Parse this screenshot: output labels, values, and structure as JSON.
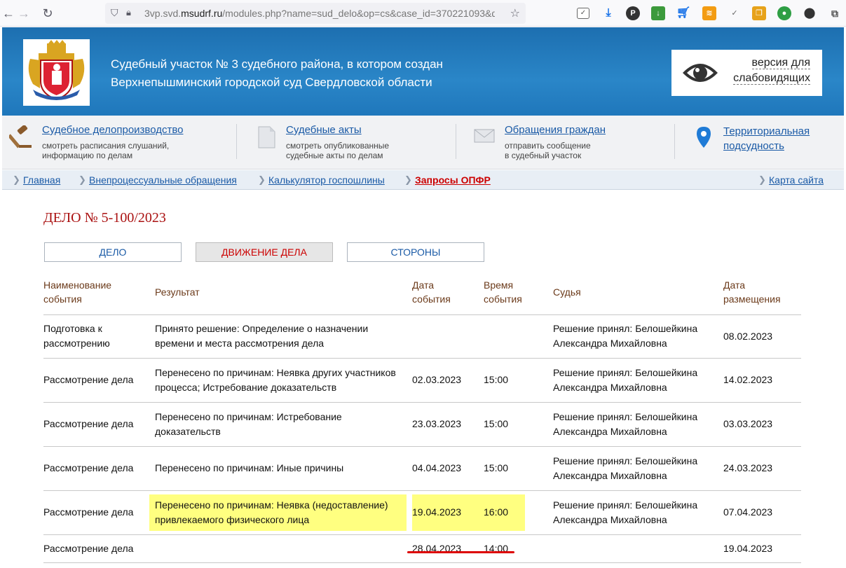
{
  "browser": {
    "url_prefix": "3vp.svd.",
    "url_domain": "msudrf.ru",
    "url_rest": "/modules.php?name=sud_delo&op=cs&case_id=370221093&de"
  },
  "header": {
    "title_line1": "Судебный участок № 3 судебного района, в котором создан",
    "title_line2": "Верхнепышминский городской суд Свердловской области",
    "accessibility_line1": "версия для",
    "accessibility_line2": "слабовидящих"
  },
  "quick_links": [
    {
      "title": "Судебное делопроизводство",
      "desc1": "смотреть расписания слушаний,",
      "desc2": "информацию по делам"
    },
    {
      "title": "Судебные акты",
      "desc1": "смотреть опубликованные",
      "desc2": "судебные акты по делам"
    },
    {
      "title": "Обращения граждан",
      "desc1": "отправить сообщение",
      "desc2": "в судебный участок"
    },
    {
      "title": "Территориальная",
      "title2": "подсудность"
    }
  ],
  "breadcrumbs": {
    "home": "Главная",
    "extra": "Внепроцессуальные обращения",
    "calc": "Калькулятор госпошлины",
    "opfr": "Запросы ОПФР",
    "sitemap": "Карта сайта"
  },
  "case": {
    "title": "ДЕЛО № 5-100/2023",
    "tabs": [
      "ДЕЛО",
      "ДВИЖЕНИЕ ДЕЛА",
      "СТОРОНЫ"
    ]
  },
  "table": {
    "headers": {
      "event": "Наименование события",
      "result": "Результат",
      "date": "Дата события",
      "time": "Время события",
      "judge": "Судья",
      "posted": "Дата размещения"
    },
    "rows": [
      {
        "event": "Подготовка к рассмотрению",
        "result": "Принято решение: Определение о назначении времени и места рассмотрения дела",
        "date": "",
        "time": "",
        "judge": "Решение принял: Белошейкина Александра Михайловна",
        "posted": "08.02.2023"
      },
      {
        "event": "Рассмотрение дела",
        "result": "Перенесено по причинам: Неявка других участников процесса; Истребование доказательств",
        "date": "02.03.2023",
        "time": "15:00",
        "judge": "Решение принял: Белошейкина Александра Михайловна",
        "posted": "14.02.2023"
      },
      {
        "event": "Рассмотрение дела",
        "result": "Перенесено по причинам: Истребование доказательств",
        "date": "23.03.2023",
        "time": "15:00",
        "judge": "Решение принял: Белошейкина Александра Михайловна",
        "posted": "03.03.2023"
      },
      {
        "event": "Рассмотрение дела",
        "result": "Перенесено по причинам: Иные причины",
        "date": "04.04.2023",
        "time": "15:00",
        "judge": "Решение принял: Белошейкина Александра Михайловна",
        "posted": "24.03.2023"
      },
      {
        "event": "Рассмотрение дела",
        "result": "Перенесено по причинам: Неявка (недоставление) привлекаемого физического лица",
        "date": "19.04.2023",
        "time": "16:00",
        "judge": "Решение принял: Белошейкина Александра Михайловна",
        "posted": "07.04.2023"
      },
      {
        "event": "Рассмотрение дела",
        "result": "",
        "date": "28.04.2023",
        "time": "14:00",
        "judge": "",
        "posted": "19.04.2023"
      }
    ]
  }
}
